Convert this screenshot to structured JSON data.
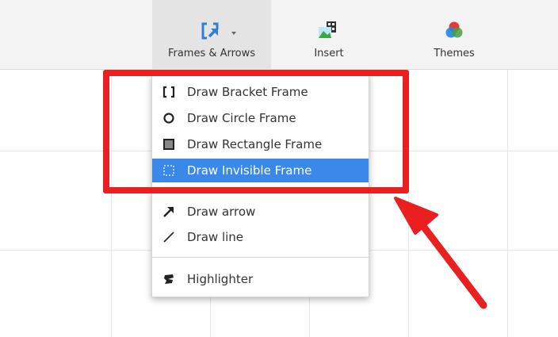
{
  "toolbar": {
    "frames_arrows_label": "Frames & Arrows",
    "insert_label": "Insert",
    "themes_label": "Themes"
  },
  "menu": {
    "items": [
      {
        "label": "Draw Bracket Frame",
        "icon": "bracket-frame-icon"
      },
      {
        "label": "Draw Circle Frame",
        "icon": "circle-frame-icon"
      },
      {
        "label": "Draw Rectangle Frame",
        "icon": "rectangle-frame-icon"
      },
      {
        "label": "Draw Invisible Frame",
        "icon": "invisible-frame-icon",
        "selected": true
      },
      {
        "label": "Draw arrow",
        "icon": "arrow-icon"
      },
      {
        "label": "Draw line",
        "icon": "line-icon"
      },
      {
        "label": "Highlighter",
        "icon": "highlighter-icon"
      }
    ]
  },
  "colors": {
    "selection": "#3a88ea",
    "annotation_red": "#ea1f1f",
    "toolbar_bg": "#f3f3f3"
  }
}
